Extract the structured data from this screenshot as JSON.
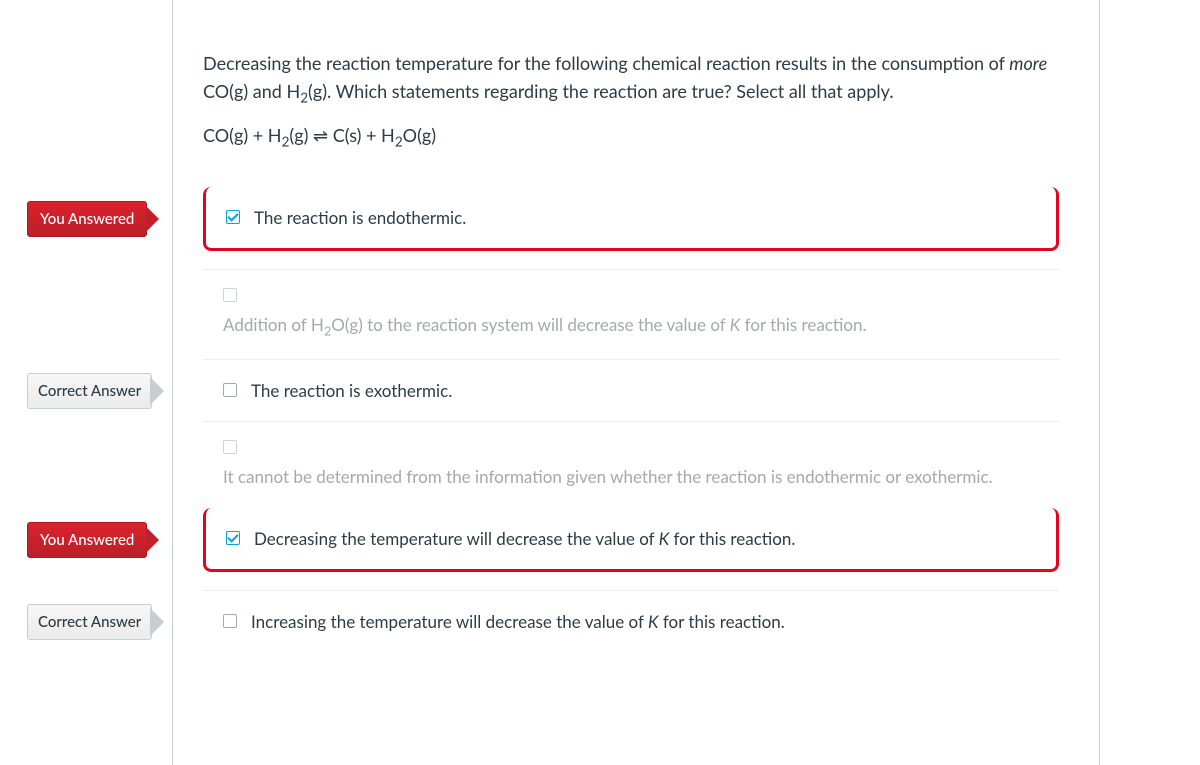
{
  "question": {
    "intro_part1": "Decreasing the reaction temperature for the following chemical reaction results in the consumption of ",
    "more_word": "more",
    "intro_part2": " CO(g) and H",
    "intro_part3": "(g).  Which statements regarding the reaction are true?  Select all that apply.",
    "equation_left": "CO(g) + H",
    "equation_mid": "(g) ",
    "equilibrium_symbol": "⇌",
    "equation_right": " C(s) + H",
    "equation_end": "O(g)"
  },
  "badges": {
    "you_answered": "You Answered",
    "correct_answer": "Correct Answer"
  },
  "answers": {
    "a1": "The reaction is endothermic.",
    "a2_part1": "Addition of H",
    "a2_part2": "O(g) to the reaction system will decrease the value of ",
    "a2_k": "K",
    "a2_part3": " for this reaction.",
    "a3": "The reaction is exothermic.",
    "a4": "It cannot be determined from the information given whether the reaction  is endothermic or exothermic.",
    "a5_part1": "Decreasing the temperature will decrease the value of ",
    "a5_k": "K",
    "a5_part2": " for this reaction.",
    "a6_part1": "Increasing the temperature will decrease the value of ",
    "a6_k": "K",
    "a6_part2": " for this reaction."
  }
}
